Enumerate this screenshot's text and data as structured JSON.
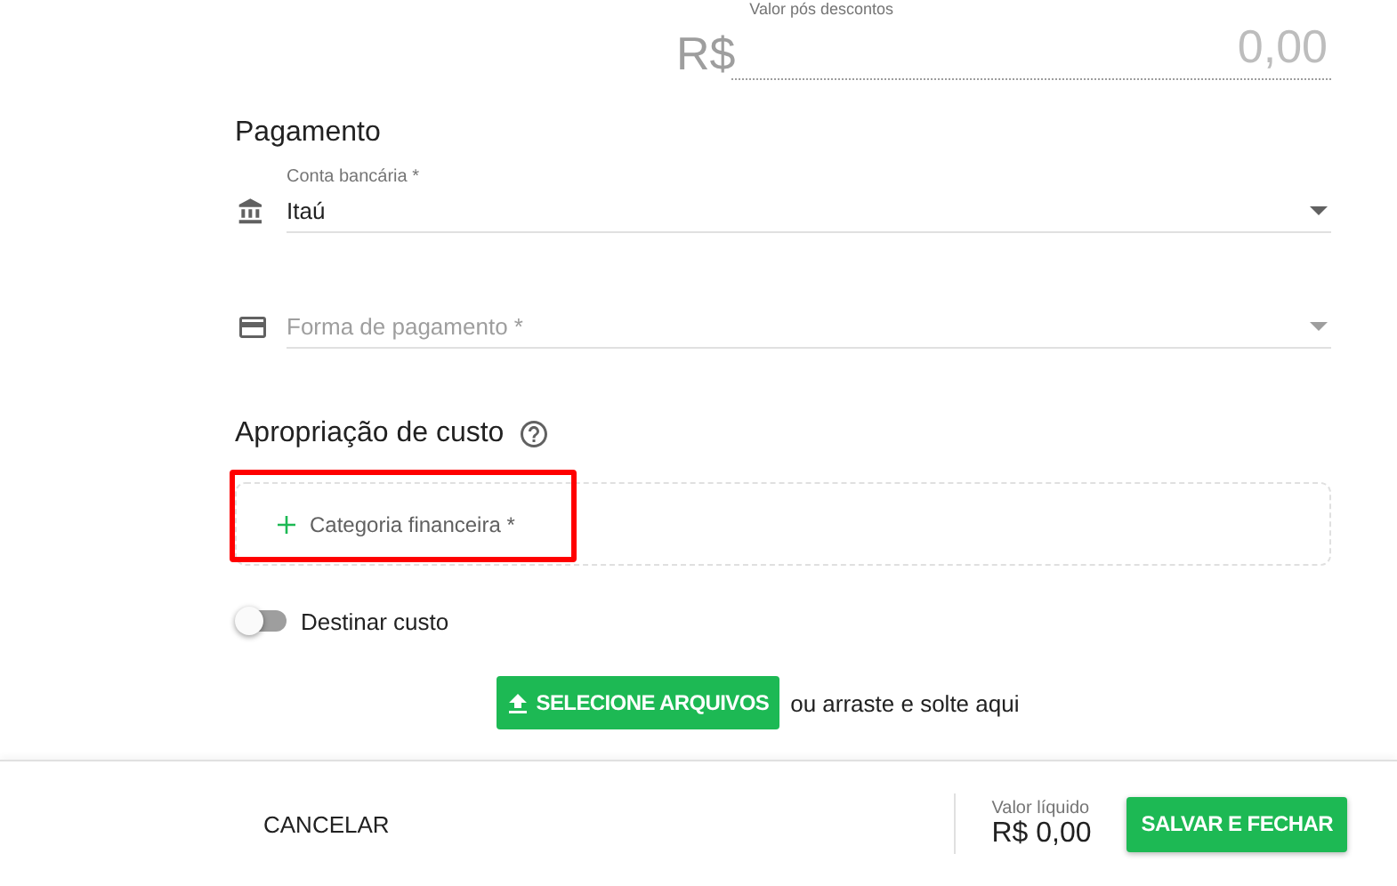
{
  "discount_value": {
    "label": "Valor pós descontos",
    "currency": "R$",
    "value": "0,00"
  },
  "payment": {
    "title": "Pagamento",
    "fields": [
      {
        "kind": "bank",
        "label": "Conta bancária *",
        "value": "Itaú"
      },
      {
        "kind": "card",
        "placeholder": "Forma de pagamento *"
      }
    ]
  },
  "cost_allocation": {
    "title": "Apropriação de custo",
    "add_label": "Categoria financeira *",
    "highlighted": true,
    "toggle": {
      "label": "Destinar custo",
      "on": false
    }
  },
  "upload": {
    "button": "SELECIONE ARQUIVOS",
    "hint": "ou arraste e solte aqui"
  },
  "footer": {
    "cancel": "CANCELAR",
    "total_label": "Valor líquido",
    "total": "R$ 0,00",
    "save": "SALVAR E FECHAR"
  }
}
